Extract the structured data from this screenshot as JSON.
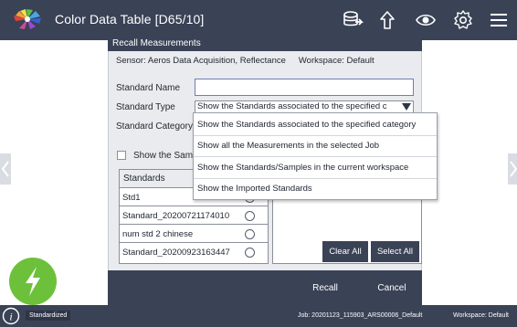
{
  "header": {
    "title": "Color Data Table [D65/10]"
  },
  "icons": {
    "logo": "color-wheel-logo",
    "toolbar": [
      "import-icon",
      "arrow-up-icon",
      "eye-icon",
      "gear-icon",
      "menu-icon"
    ],
    "fab": "lightning-icon",
    "info": "info-icon"
  },
  "dialog": {
    "title": "Recall Measurements",
    "sensor_label": "Sensor: Aeros Data Acquisition, Reflectance",
    "workspace_label": "Workspace: Default",
    "standard_name_label": "Standard Name",
    "standard_name_value": "",
    "standard_type_label": "Standard Type",
    "standard_type_value": "Show the Standards associated to the specified c",
    "standard_category_label": "Standard Category",
    "dropdown_options": [
      "Show the Standards associated to the specified category",
      "Show all the Measurements in the selected Job",
      "Show the Standards/Samples in the current workspace",
      "Show the Imported Standards"
    ],
    "show_checkbox_label": "Show the Sam",
    "list_header": "Standards",
    "standards": [
      {
        "name": "Std1",
        "selected": true
      },
      {
        "name": "Standard_20200721174010",
        "selected": false
      },
      {
        "name": "num std 2 chinese",
        "selected": false
      },
      {
        "name": "Standard_20200923163447",
        "selected": false
      }
    ],
    "clear_all_label": "Clear All",
    "select_all_label": "Select All",
    "recall_label": "Recall",
    "cancel_label": "Cancel"
  },
  "status": {
    "mode": "Standardized",
    "job": "Job: 20201123_115903_ARS00006_Default",
    "workspace": "Workspace: Default"
  },
  "colors": {
    "bar": "#3a4256",
    "dialog_bg": "#eaebee",
    "fab": "#6dc13a"
  }
}
